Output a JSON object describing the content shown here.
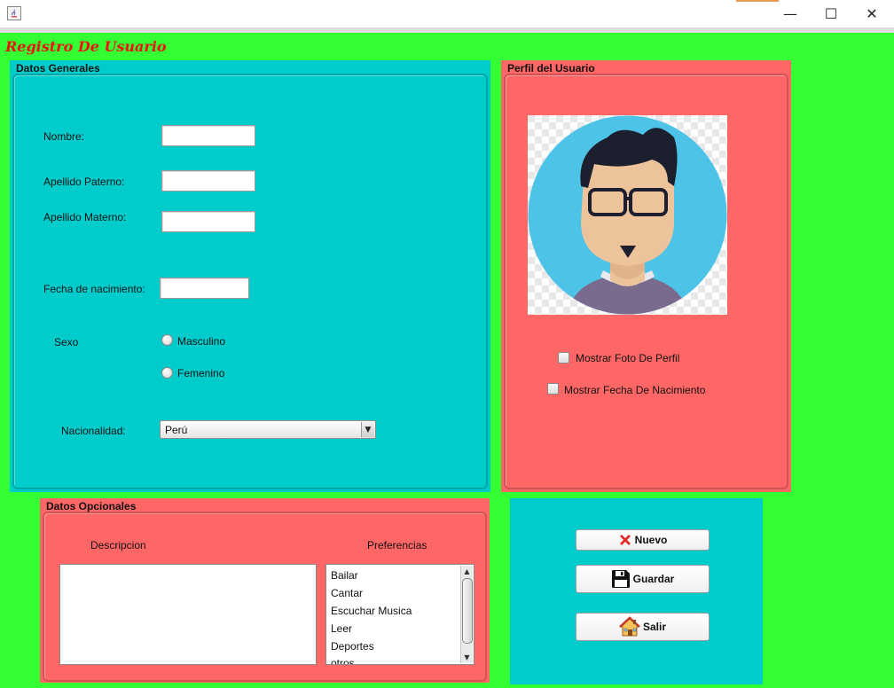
{
  "window": {
    "title": "",
    "minimize_glyph": "—",
    "maximize_glyph": "☐",
    "close_glyph": "✕"
  },
  "app_title": "Registro De Usuario",
  "datos_generales": {
    "title": "Datos Generales",
    "nombre_label": "Nombre:",
    "nombre_value": "",
    "paterno_label": "Apellido Paterno:",
    "paterno_value": "",
    "materno_label": "Apellido Materno:",
    "materno_value": "",
    "fecha_label": "Fecha de nacimiento:",
    "fecha_value": "",
    "sexo_label": "Sexo",
    "masculino_label": "Masculino",
    "femenino_label": "Femenino",
    "nacionalidad_label": "Nacionalidad:",
    "nacionalidad_value": "Perú"
  },
  "perfil": {
    "title": "Perfil del Usuario",
    "avatar_icon": "user-avatar-icon",
    "mostrar_foto_label": "Mostrar Foto De Perfil",
    "mostrar_fecha_label": "Mostrar Fecha De Nacimiento"
  },
  "opcionales": {
    "title": "Datos Opcionales",
    "descripcion_label": "Descripcion",
    "preferencias_label": "Preferencias",
    "preferencias": [
      "Bailar",
      "Cantar",
      "Escuchar Musica",
      "Leer",
      "Deportes",
      "otros"
    ]
  },
  "actions": {
    "nuevo_label": "Nuevo",
    "nuevo_icon": "red-x-icon",
    "guardar_label": "Guardar",
    "guardar_icon": "floppy-disk-icon",
    "salir_label": "Salir",
    "salir_icon": "house-icon"
  },
  "colors": {
    "background": "#33ff33",
    "teal_panel": "#00cccc",
    "salmon_panel": "#ff6666",
    "title_red": "#ee1111"
  }
}
